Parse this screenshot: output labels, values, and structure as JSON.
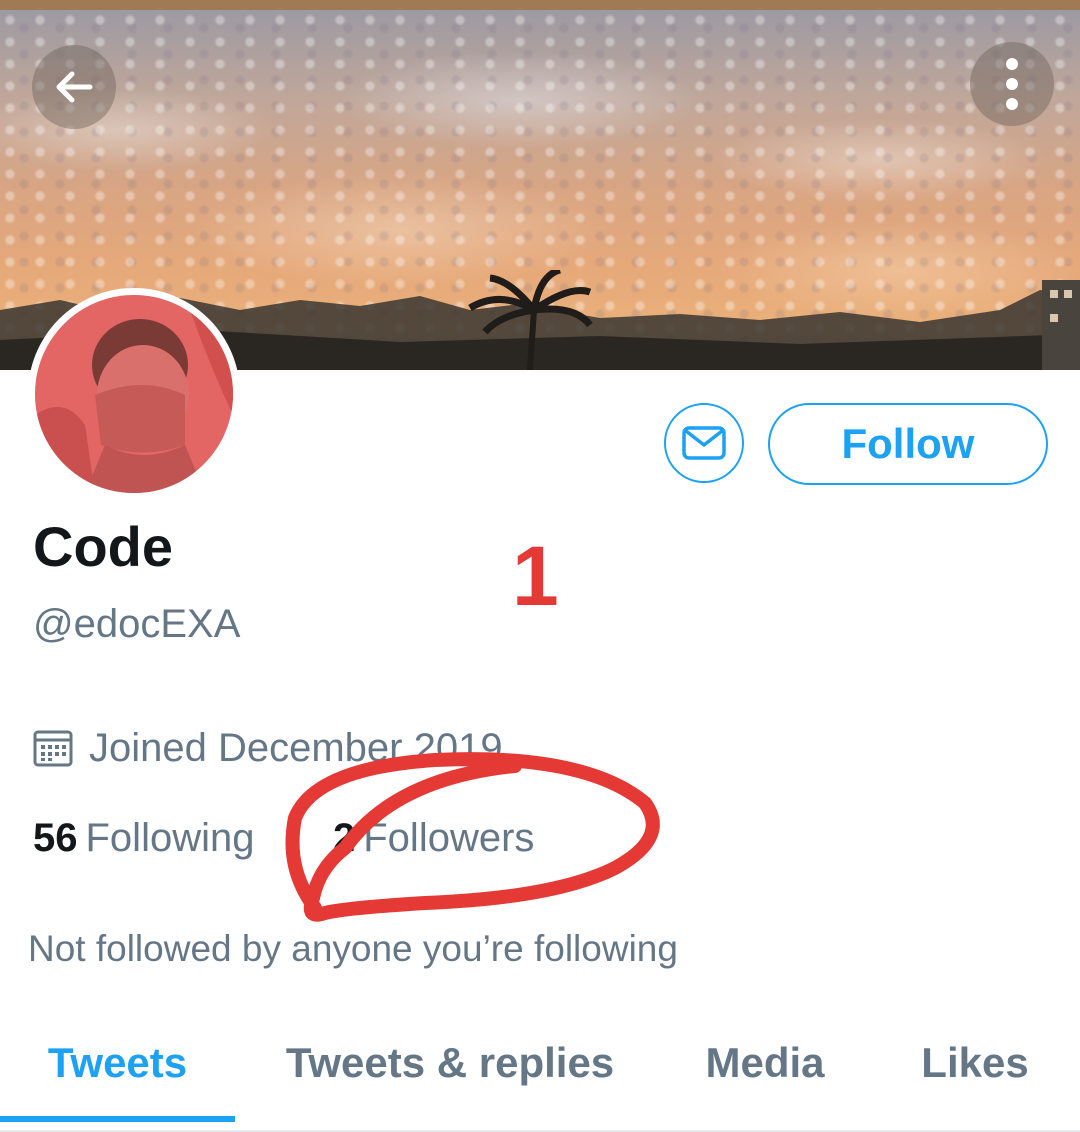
{
  "header": {
    "back_icon": "arrow-left-icon",
    "more_icon": "more-vertical-icon"
  },
  "profile": {
    "display_name": "Code",
    "handle": "@edocEXA",
    "joined": "Joined December 2019",
    "joined_icon": "calendar-icon",
    "following_count": "56",
    "following_label": "Following",
    "followers_count": "2",
    "followers_label": "Followers",
    "mutual_text": "Not followed by anyone you’re following"
  },
  "actions": {
    "message_icon": "mail-icon",
    "follow_label": "Follow"
  },
  "annotation": {
    "label": "1",
    "color": "#e53935"
  },
  "tabs": [
    {
      "label": "Tweets",
      "active": true
    },
    {
      "label": "Tweets & replies",
      "active": false
    },
    {
      "label": "Media",
      "active": false
    },
    {
      "label": "Likes",
      "active": false
    }
  ],
  "colors": {
    "accent": "#1da1f2",
    "text_primary": "#14171a",
    "text_secondary": "#657786"
  }
}
